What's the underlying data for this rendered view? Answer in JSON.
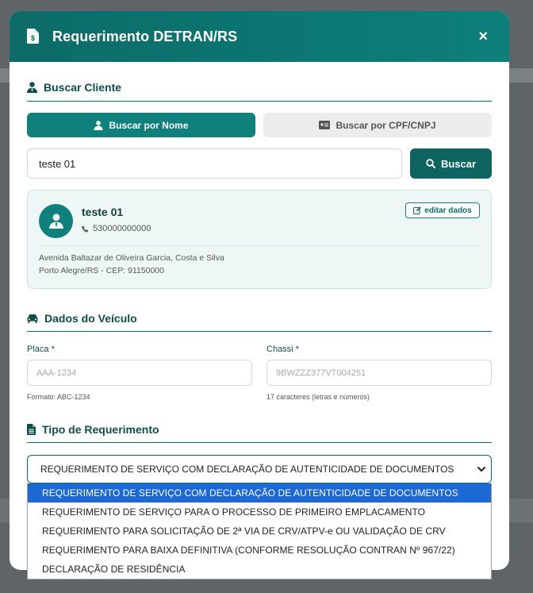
{
  "modal": {
    "title": "Requerimento DETRAN/RS",
    "close_label": "×"
  },
  "search_section": {
    "title": "Buscar Cliente",
    "tab_name": "Buscar por Nome",
    "tab_doc": "Buscar por CPF/CNPJ",
    "input_value": "teste 01",
    "search_button": "Buscar"
  },
  "client": {
    "name": "teste 01",
    "phone": "530000000000",
    "edit_label": "editar dados",
    "address_line1": "Avenida Baltazar de Oliveira Garcia, Costa e Silva",
    "address_line2": "Porto Alegre/RS - CEP: 91150000"
  },
  "vehicle_section": {
    "title": "Dados do Veículo",
    "plate_label": "Placa *",
    "plate_placeholder": "AAA-1234",
    "plate_hint": "Formato: ABC-1234",
    "chassis_label": "Chassi *",
    "chassis_placeholder": "9BWZZZ377VT004251",
    "chassis_hint": "17 caracteres (letras e números)"
  },
  "request_section": {
    "title": "Tipo de Requerimento",
    "selected": "REQUERIMENTO DE SERVIÇO COM DECLARAÇÃO DE AUTENTICIDADE DE DOCUMENTOS",
    "options": [
      "REQUERIMENTO DE SERVIÇO COM DECLARAÇÃO DE AUTENTICIDADE DE DOCUMENTOS",
      "REQUERIMENTO DE SERVIÇO PARA O PROCESSO DE PRIMEIRO EMPLACAMENTO",
      "REQUERIMENTO PARA SOLICITAÇÃO DE 2ª VIA DE CRV/ATPV-e OU VALIDAÇÃO DE CRV",
      "REQUERIMENTO PARA BAIXA DEFINITIVA (CONFORME RESOLUÇÃO CONTRAN Nº 967/22)",
      "DECLARAÇÃO DE RESIDÊNCIA"
    ]
  },
  "colors": {
    "primary": "#0f807c",
    "header": "#0b6b68",
    "highlight": "#1c68d4"
  }
}
